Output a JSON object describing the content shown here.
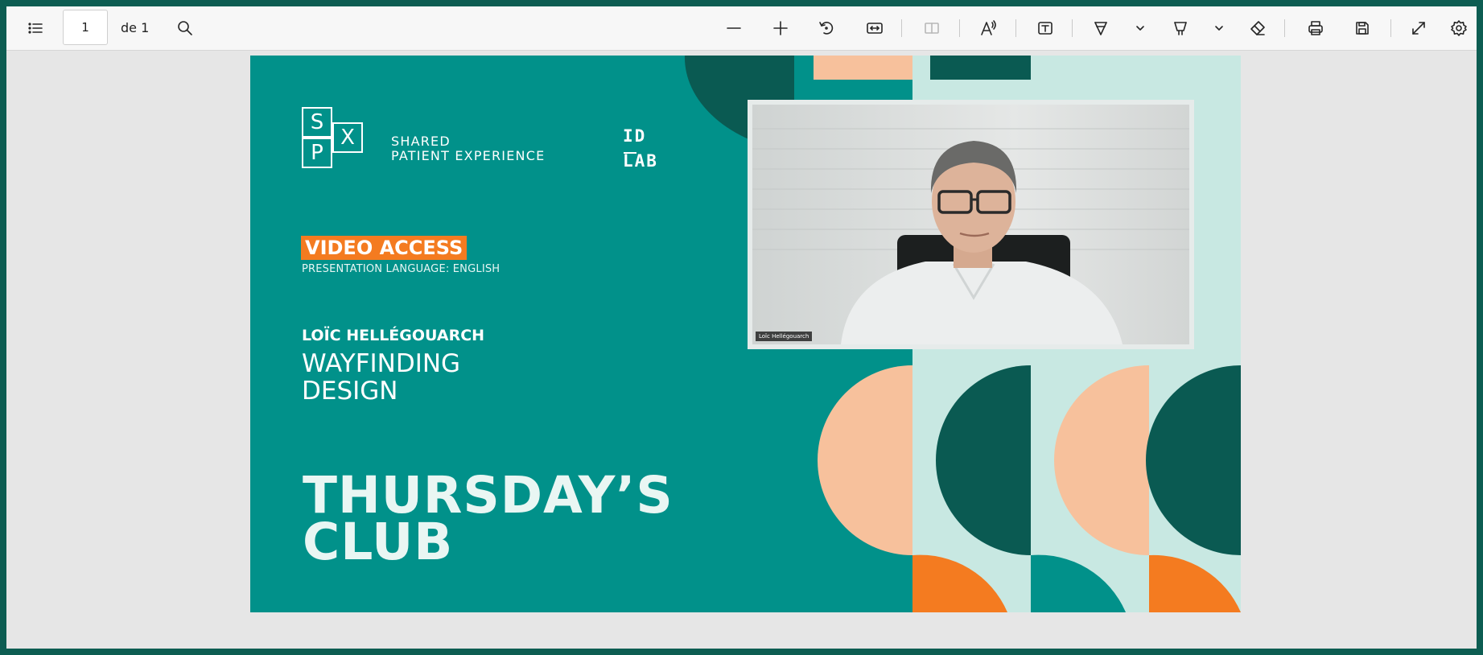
{
  "toolbar": {
    "page_number": "1",
    "page_of": "de 1",
    "icons": [
      "toc-list-icon",
      "search-icon",
      "zoom-out-icon",
      "zoom-in-icon",
      "rotate-icon",
      "fit-width-icon",
      "page-view-icon",
      "read-aloud-icon",
      "text-box-icon",
      "draw-icon",
      "highlight-icon",
      "eraser-icon",
      "print-icon",
      "save-icon",
      "fullscreen-icon",
      "settings-icon"
    ]
  },
  "slide": {
    "logo_letters": {
      "s": "S",
      "x": "X",
      "p": "P"
    },
    "logo_line1": "SHARED",
    "logo_line2": "PATIENT EXPERIENCE",
    "idlab_line1": "ID",
    "idlab_line2": "LAB",
    "badge": "VIDEO ACCESS",
    "language": "PRESENTATION LANGUAGE: ENGLISH",
    "speaker": "LOÏC HELLÉGOUARCH",
    "talk_line1": "WAYFINDING",
    "talk_line2": "DESIGN",
    "club_line1": "THURSDAY’S",
    "club_line2": "CLUB",
    "video_name_tag": "Loïc Hellégouarch"
  },
  "colors": {
    "slide_teal": "#01918a",
    "dark_teal": "#0a5a52",
    "peach": "#f7c19c",
    "orange": "#f47b20",
    "mint": "#c8e8e2"
  }
}
